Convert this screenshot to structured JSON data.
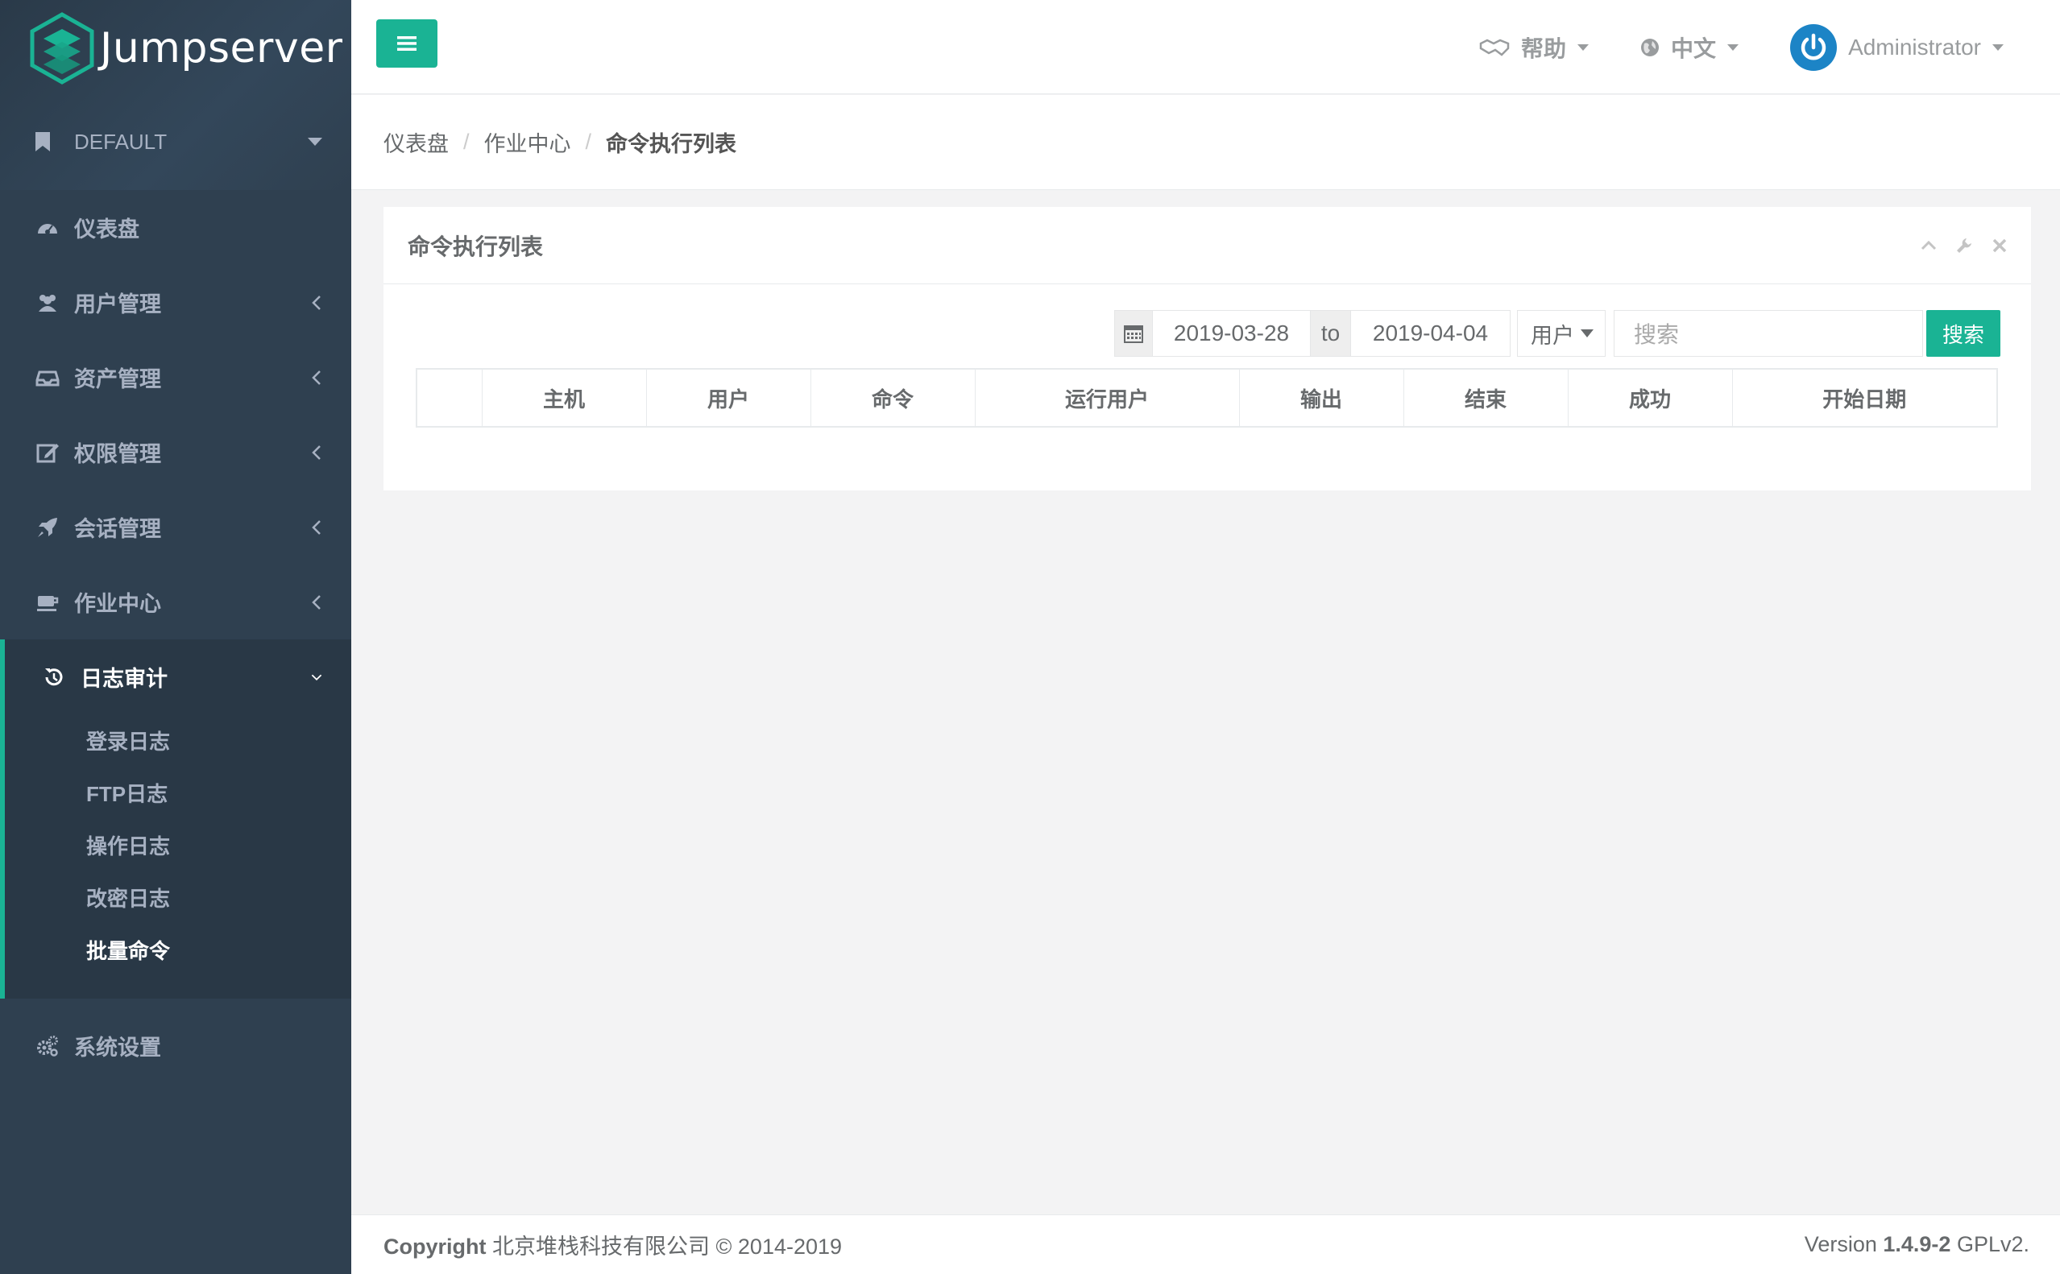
{
  "brand": {
    "name": "Jumpserver"
  },
  "sidebar": {
    "org": "DEFAULT",
    "items": [
      {
        "label": "仪表盘"
      },
      {
        "label": "用户管理"
      },
      {
        "label": "资产管理"
      },
      {
        "label": "权限管理"
      },
      {
        "label": "会话管理"
      },
      {
        "label": "作业中心"
      },
      {
        "label": "日志审计"
      },
      {
        "label": "系统设置"
      }
    ],
    "sub_items": [
      {
        "label": "登录日志"
      },
      {
        "label": "FTP日志"
      },
      {
        "label": "操作日志"
      },
      {
        "label": "改密日志"
      },
      {
        "label": "批量命令"
      }
    ]
  },
  "topbar": {
    "help": "帮助",
    "language": "中文",
    "user": "Administrator"
  },
  "breadcrumb": {
    "items": [
      "仪表盘",
      "作业中心",
      "命令执行列表"
    ],
    "separator": "/"
  },
  "panel": {
    "title": "命令执行列表",
    "filter": {
      "date_from": "2019-03-28",
      "to_label": "to",
      "date_to": "2019-04-04",
      "field_select": "用户",
      "search_placeholder": "搜索",
      "search_button": "搜索"
    },
    "columns": [
      "",
      "主机",
      "用户",
      "命令",
      "运行用户",
      "输出",
      "结束",
      "成功",
      "开始日期"
    ]
  },
  "footer": {
    "copyright_label": "Copyright",
    "company": "北京堆栈科技有限公司 © 2014-2019",
    "version_label": "Version",
    "version": "1.4.9-2",
    "license": "GPLv2."
  },
  "colors": {
    "sidebar_bg": "#2f4050",
    "accent": "#1ab394",
    "avatar": "#1c84c6"
  }
}
